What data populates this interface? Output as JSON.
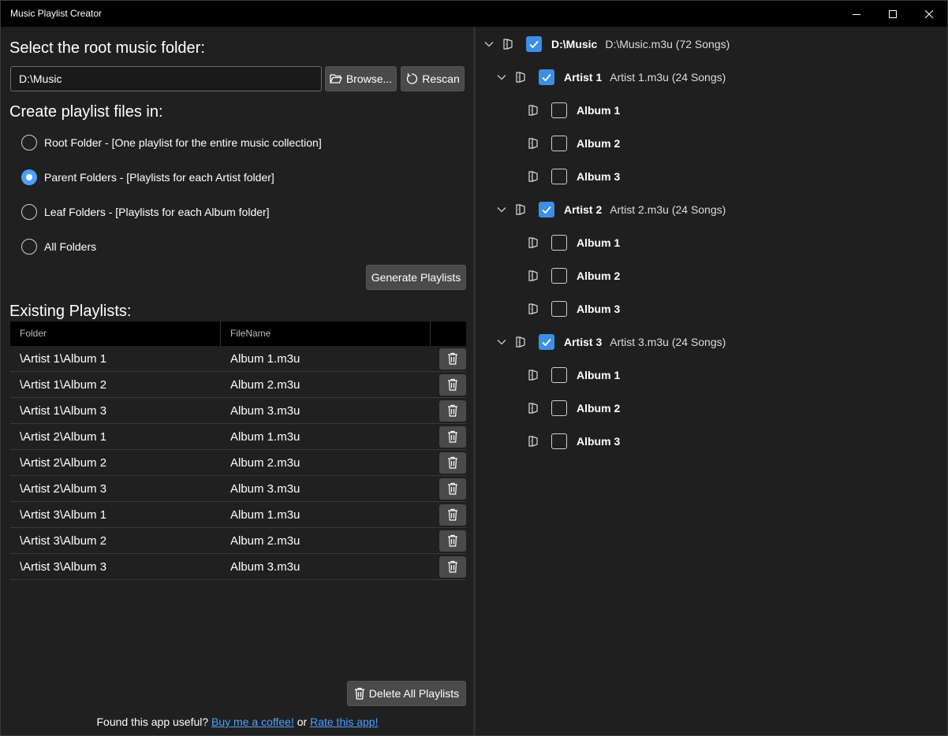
{
  "window": {
    "title": "Music Playlist Creator"
  },
  "root_section": {
    "heading": "Select the root music folder:",
    "path_value": "D:\\Music",
    "browse_label": "Browse...",
    "rescan_label": "Rescan"
  },
  "options": {
    "heading": "Create playlist files in:",
    "items": [
      {
        "label": "Root Folder - [One playlist for the entire music collection]",
        "checked": false
      },
      {
        "label": "Parent Folders - [Playlists for each Artist folder]",
        "checked": true
      },
      {
        "label": "Leaf Folders - [Playlists for each Album folder]",
        "checked": false
      },
      {
        "label": "All Folders",
        "checked": false
      }
    ],
    "generate_label": "Generate Playlists"
  },
  "existing": {
    "heading": "Existing Playlists:",
    "columns": [
      "Folder",
      "FileName"
    ],
    "rows": [
      {
        "folder": "\\Artist 1\\Album 1",
        "file": "Album 1.m3u"
      },
      {
        "folder": "\\Artist 1\\Album 2",
        "file": "Album 2.m3u"
      },
      {
        "folder": "\\Artist 1\\Album 3",
        "file": "Album 3.m3u"
      },
      {
        "folder": "\\Artist 2\\Album 1",
        "file": "Album 1.m3u"
      },
      {
        "folder": "\\Artist 2\\Album 2",
        "file": "Album 2.m3u"
      },
      {
        "folder": "\\Artist 2\\Album 3",
        "file": "Album 3.m3u"
      },
      {
        "folder": "\\Artist 3\\Album 1",
        "file": "Album 1.m3u"
      },
      {
        "folder": "\\Artist 3\\Album 2",
        "file": "Album 2.m3u"
      },
      {
        "folder": "\\Artist 3\\Album 3",
        "file": "Album 3.m3u"
      }
    ],
    "delete_all_label": "Delete All Playlists"
  },
  "footer": {
    "prefix": "Found this app useful?",
    "coffee_link": "Buy me a coffee!",
    "middle": "or",
    "rate_link": "Rate this app!"
  },
  "tree": {
    "root": {
      "name": "D:\\Music",
      "info": "D:\\Music.m3u (72 Songs)",
      "checked": true
    },
    "artists": [
      {
        "name": "Artist 1",
        "info": "Artist 1.m3u (24 Songs)",
        "checked": true,
        "albums": [
          {
            "name": "Album 1"
          },
          {
            "name": "Album 2"
          },
          {
            "name": "Album 3"
          }
        ]
      },
      {
        "name": "Artist 2",
        "info": "Artist 2.m3u (24 Songs)",
        "checked": true,
        "albums": [
          {
            "name": "Album 1"
          },
          {
            "name": "Album 2"
          },
          {
            "name": "Album 3"
          }
        ]
      },
      {
        "name": "Artist 3",
        "info": "Artist 3.m3u (24 Songs)",
        "checked": true,
        "albums": [
          {
            "name": "Album 1"
          },
          {
            "name": "Album 2"
          },
          {
            "name": "Album 3"
          }
        ]
      }
    ]
  },
  "colors": {
    "accent": "#3b8fe8",
    "link": "#4ca0ff",
    "background": "#202020"
  }
}
